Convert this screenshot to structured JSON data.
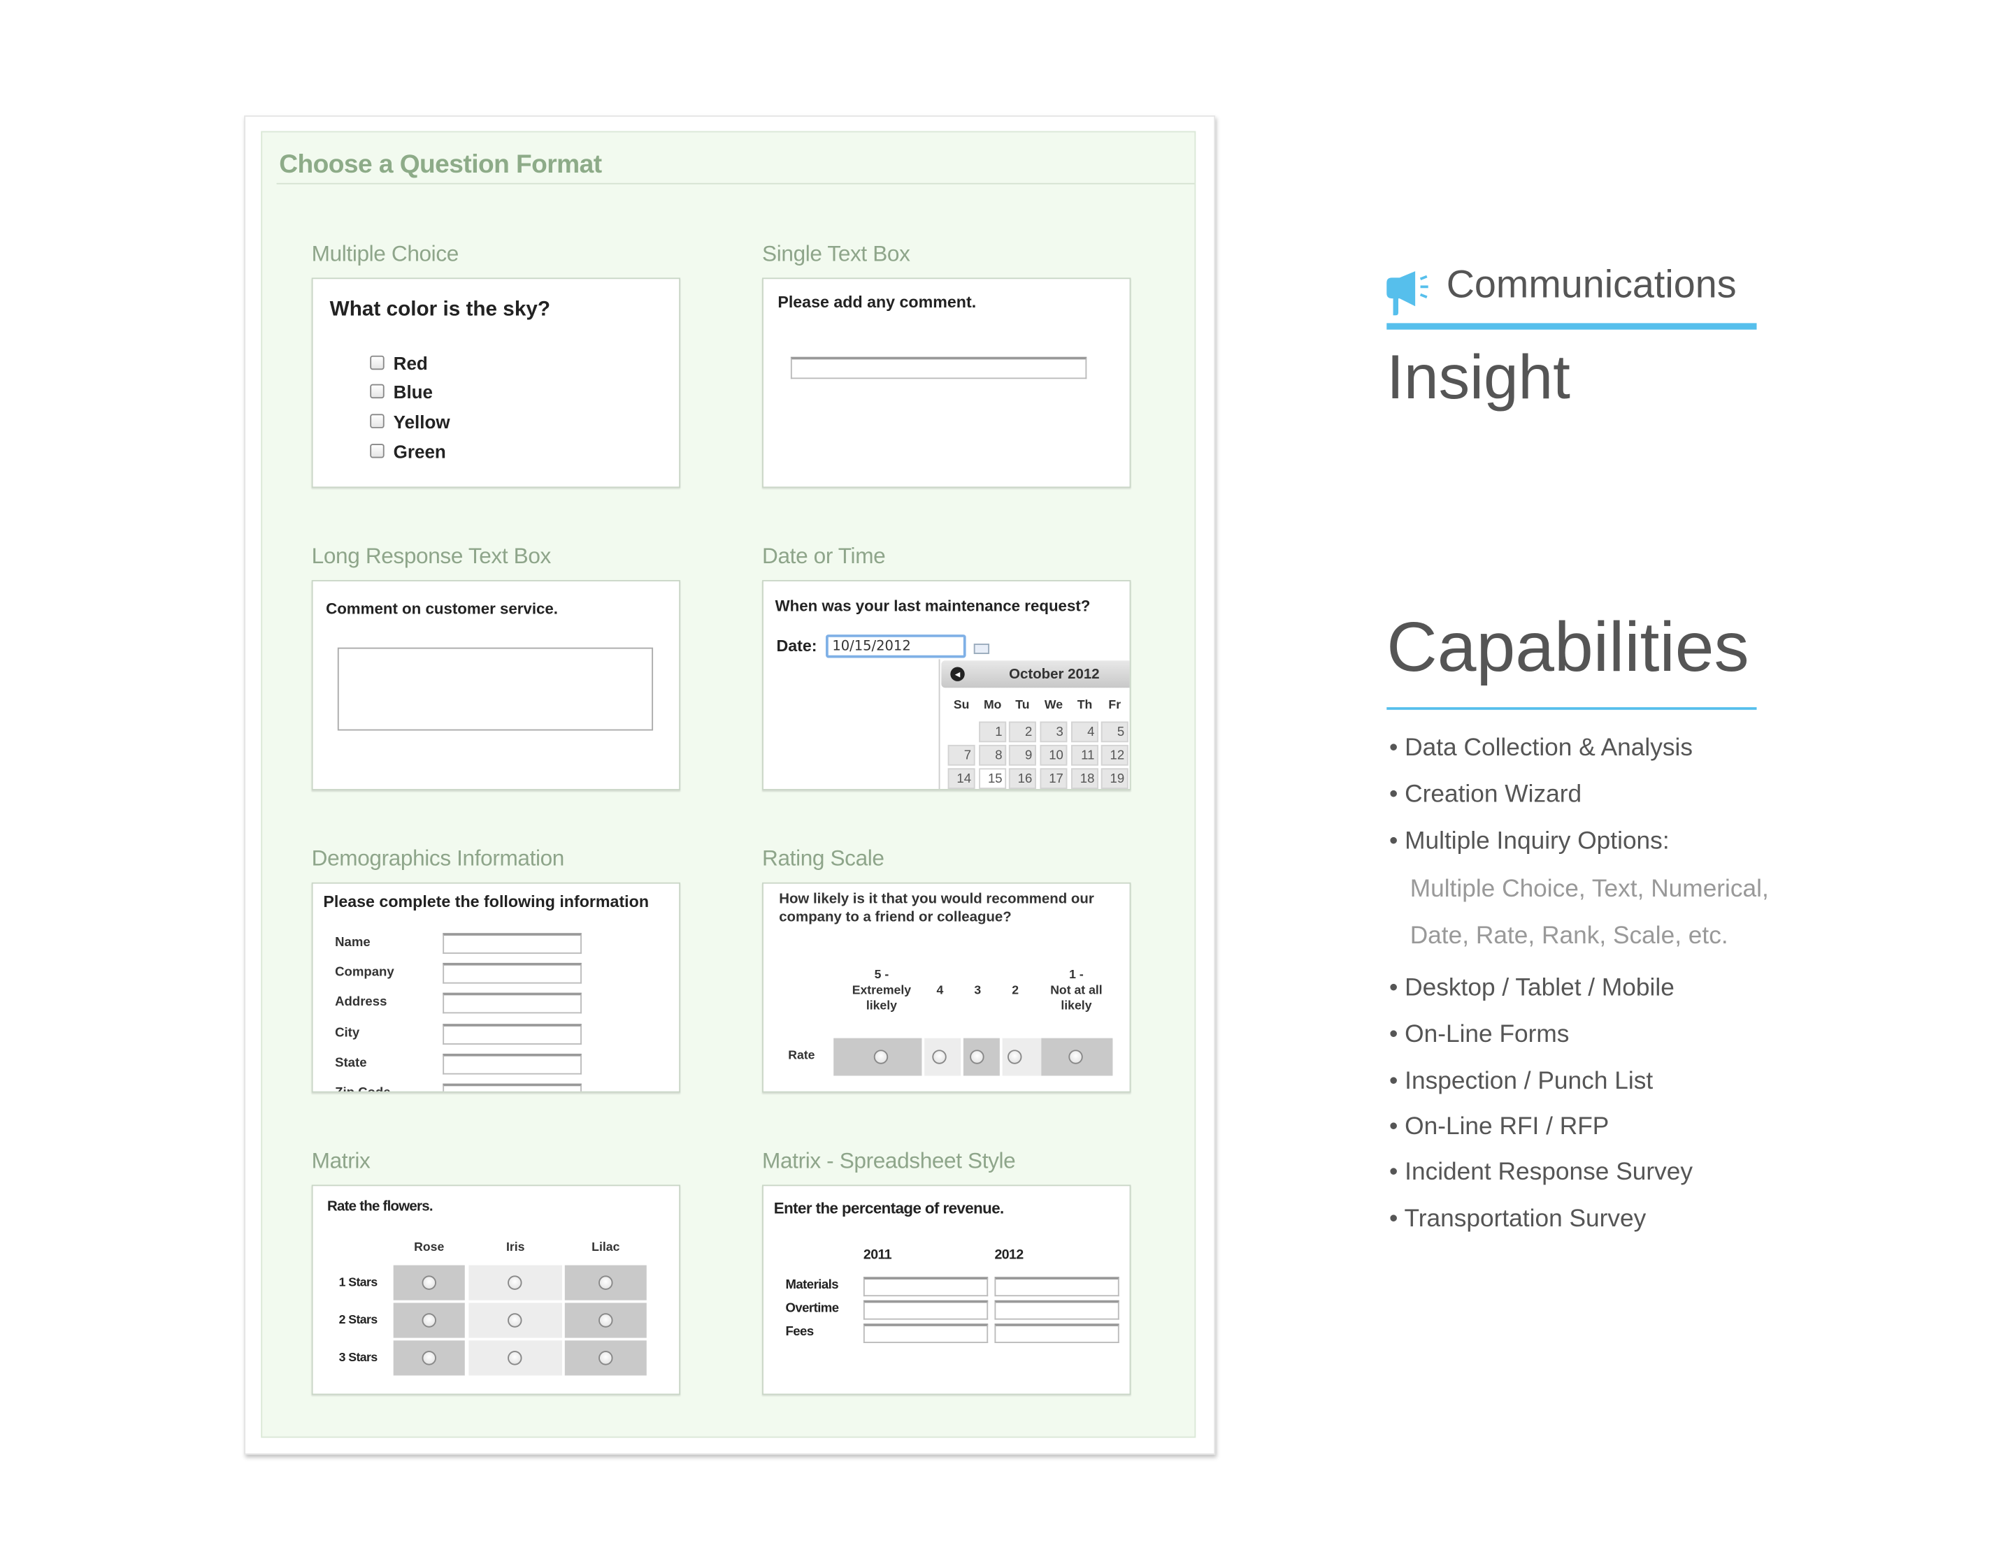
{
  "panel": {
    "title": "Choose a Question Format"
  },
  "multiple_choice": {
    "label": "Multiple Choice",
    "question": "What color is the sky?",
    "options": [
      "Red",
      "Blue",
      "Yellow",
      "Green"
    ]
  },
  "single_text": {
    "label": "Single Text Box",
    "question": "Please add any comment.",
    "value": ""
  },
  "long_text": {
    "label": "Long Response Text Box",
    "question": "Comment on customer service.",
    "value": ""
  },
  "date_time": {
    "label": "Date or Time",
    "question": "When was your last maintenance request?",
    "date_label": "Date:",
    "date_value": "10/15/2012",
    "calendar": {
      "month": "October 2012",
      "weekdays": [
        "Su",
        "Mo",
        "Tu",
        "We",
        "Th",
        "Fr"
      ],
      "rows": [
        [
          "",
          "1",
          "2",
          "3",
          "4",
          "5"
        ],
        [
          "7",
          "8",
          "9",
          "10",
          "11",
          "12"
        ],
        [
          "14",
          "15",
          "16",
          "17",
          "18",
          "19"
        ]
      ],
      "selected": "15"
    }
  },
  "demographics": {
    "label": "Demographics Information",
    "question": "Please complete the following information",
    "fields": [
      "Name",
      "Company",
      "Address",
      "City",
      "State",
      "Zip Code"
    ]
  },
  "rating": {
    "label": "Rating Scale",
    "question_line1": "How likely is it that you would recommend our",
    "question_line2": "company to a friend or colleague?",
    "scale": [
      [
        "5 -",
        "Extremely",
        "likely"
      ],
      [
        "4"
      ],
      [
        "3"
      ],
      [
        "2"
      ],
      [
        "1 -",
        "Not at all",
        "likely"
      ]
    ],
    "row_label": "Rate"
  },
  "matrix": {
    "label": "Matrix",
    "question": "Rate the flowers.",
    "columns": [
      "Rose",
      "Iris",
      "Lilac"
    ],
    "rows": [
      "1 Stars",
      "2 Stars",
      "3 Stars"
    ]
  },
  "spreadsheet": {
    "label": "Matrix - Spreadsheet Style",
    "question": "Enter the percentage of revenue.",
    "columns": [
      "2011",
      "2012"
    ],
    "rows": [
      "Materials",
      "Overtime",
      "Fees"
    ]
  },
  "sidebar": {
    "category": "Communications",
    "category_icon": "megaphone-icon",
    "product": "Insight",
    "capabilities_title": "Capabilities",
    "accent": "#56bfec",
    "items": [
      "• Data Collection & Analysis",
      "• Creation Wizard",
      "• Multiple Inquiry Options:"
    ],
    "sub_items": [
      "Multiple Choice, Text, Numerical,",
      "Date, Rate, Rank, Scale, etc."
    ],
    "items2": [
      "• Desktop / Tablet / Mobile",
      "• On-Line Forms",
      "• Inspection / Punch List",
      "• On-Line RFI / RFP",
      "• Incident Response Survey",
      "• Transportation Survey"
    ]
  }
}
